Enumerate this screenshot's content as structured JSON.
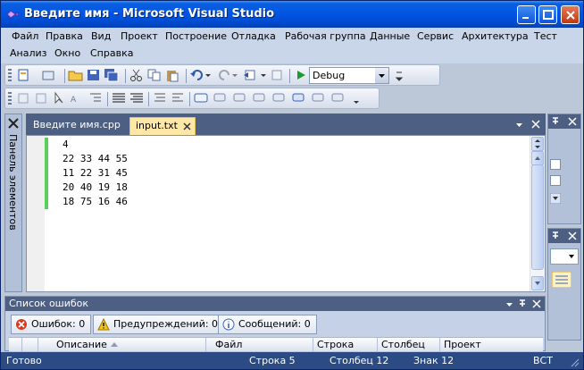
{
  "window": {
    "title": "Введите имя - Microsoft Visual Studio"
  },
  "menu": {
    "items": [
      "Файл",
      "Правка",
      "Вид",
      "Проект",
      "Построение",
      "Отладка",
      "Рабочая группа",
      "Данные",
      "Сервис",
      "Архитектура",
      "Тест",
      "Анализ",
      "Окно",
      "Справка"
    ]
  },
  "toolbar": {
    "config_value": "Debug"
  },
  "toolbox": {
    "label": "Панель элементов"
  },
  "tabs": [
    {
      "label": "Введите имя.cpp",
      "active": false
    },
    {
      "label": "input.txt",
      "active": true
    }
  ],
  "editor": {
    "lines": [
      "4",
      "22 33 44 55",
      "11 22 31 45",
      "20 40 19 18",
      "18 75 16 46"
    ]
  },
  "error_list": {
    "title": "Список ошибок",
    "errors_label": "Ошибок: 0",
    "warnings_label": "Предупреждений: 0",
    "messages_label": "Сообщений: 0",
    "columns": [
      "Описание",
      "Файл",
      "Строка",
      "Столбец",
      "Проект"
    ]
  },
  "status": {
    "ready": "Готово",
    "line": "Строка 5",
    "column": "Столбец 12",
    "char": "Знак 12",
    "mode": "ВСТ"
  },
  "colors": {
    "title_bar": "#0054e3",
    "active_tab": "#ffe8a6",
    "status_bar": "#2c4a84",
    "change_bar": "#5ad05a"
  }
}
